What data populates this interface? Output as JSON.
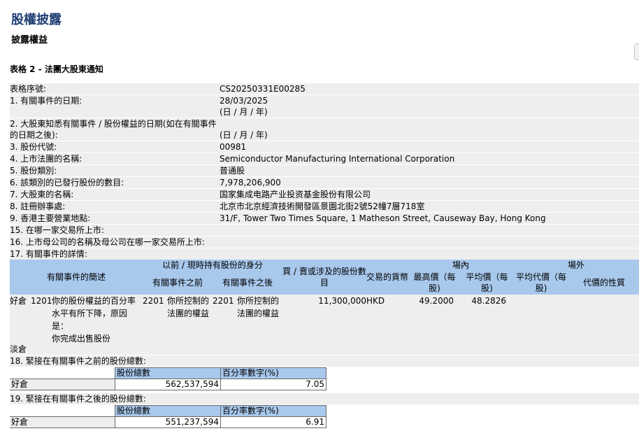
{
  "header": {
    "title": "股權披露",
    "subtitle": "披露權益"
  },
  "form_title": "表格 2 - 法團大股東通知",
  "fields": [
    {
      "label": "表格序號:",
      "value": "CS20250331E00285"
    },
    {
      "label": "1. 有關事件的日期:",
      "value": "28/03/2025",
      "note": "(日 / 月 / 年)"
    },
    {
      "label": "2. 大股東知悉有關事件 / 股份權益的日期(如在有關事件",
      "label2": "的日期之後):",
      "value": "",
      "note": "(日 / 月 / 年)"
    },
    {
      "label": "3. 股份代號:",
      "value": "00981"
    },
    {
      "label": "4. 上市法團的名稱:",
      "value": "Semiconductor Manufacturing International Corporation"
    },
    {
      "label": "5. 股份類別:",
      "value": "普通股"
    },
    {
      "label": "6. 該類別的已發行股份的數目:",
      "value": "7,978,206,900"
    },
    {
      "label": "7. 大股東的名稱:",
      "value": "国家集成电路产业投资基金股份有限公司"
    },
    {
      "label": "8. 註冊辦事處:",
      "value": "北京市北京經濟技術開發區景園北街2號52幢7層718室"
    },
    {
      "label": "9. 香港主要營業地點:",
      "value": "31/F, Tower Two Times Square, 1 Matheson Street, Causeway Bay, Hong Kong"
    },
    {
      "label": "15. 在哪一家交易所上市:",
      "value": ""
    },
    {
      "label": "16. 上市母公司的名稱及母公司在哪一家交易所上市:",
      "value": ""
    },
    {
      "label": "17. 有關事件的詳情:",
      "value": ""
    }
  ],
  "event_table": {
    "h_summary": "有關事件的簡述",
    "h_before_after": "以前 / 現時持有股份的身分",
    "h_before": "有關事件之前",
    "h_after": "有關事件之後",
    "h_shares": "買 / 賣或涉及的股份數目",
    "h_currency": "交易的貨幣",
    "h_on_exchange": "場內",
    "h_high": "最高價（每股)",
    "h_avg": "平均價（每股)",
    "h_off_exchange": "場外",
    "h_avg_off": "平均代價（每股)",
    "h_nature": "代價的性質",
    "row": {
      "position": "好倉",
      "code": "1201",
      "desc_lines": [
        "你的股份權益的百分率",
        "水平有所下降，原因",
        "是：",
        "你完成出售股份"
      ],
      "before_code": "2201",
      "before_lines": [
        "你所控制的",
        "法團的權益"
      ],
      "after_code": "2201",
      "after_lines": [
        "你所控制的",
        "法團的權益"
      ],
      "shares": "11,300,000",
      "currency": "HKD",
      "high": "49.2000",
      "avg": "48.2826"
    }
  },
  "short_label": "淡倉",
  "sec18": {
    "label": "18. 緊接在有關事件之前的股份總數:",
    "h_total": "股份總數",
    "h_pct": "百分率數字(%)",
    "row_label": "好倉",
    "total": "562,537,594",
    "pct": "7.05"
  },
  "sec19": {
    "label": "19. 緊接在有關事件之後的股份總數:",
    "h_total": "股份總數",
    "h_pct": "百分率數字(%)",
    "row_label": "好倉",
    "total": "551,237,594",
    "pct": "6.91"
  }
}
